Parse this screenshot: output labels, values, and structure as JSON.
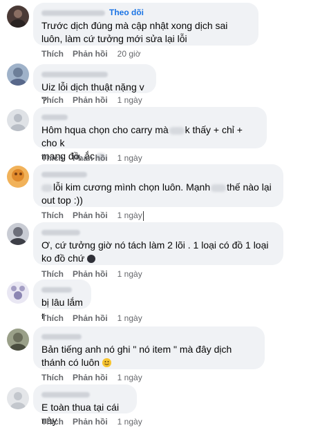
{
  "actions": {
    "like_label": "Thích",
    "reply_label": "Phản hồi"
  },
  "comments": [
    {
      "author_follow_label": "Theo dõi",
      "text_plain": "Trước dịch đúng mà cập nhật xong dịch sai luôn, làm cứ tưởng mới sửa lại lỗi",
      "time": "20 giờ",
      "avatar_color": "#4a3a36"
    },
    {
      "text_plain": "Uiz lỗi dịch thuật nặng v ?",
      "time": "1 ngày",
      "avatar_color": "#7c8fa8"
    },
    {
      "text_line1_a": "Hôm hqua chọn cho carry mà",
      "text_line1_b": "k thấy + chỉ + cho k",
      "text_line2_a": "mang đồ, ắc",
      "time": "1 ngày",
      "avatar_color": "#d7dbe0"
    },
    {
      "text_line1_a": "lỗi kim cương mình chọn luôn. Mạnh",
      "text_line1_b": "thế nào lại",
      "text_line2": "out top :))",
      "time": "1 ngày",
      "avatar_color": "#e08a2c"
    },
    {
      "text_plain": "Ơ, cứ tưởng giờ nó tách làm 2 lõi . 1 loại có đồ 1 loại ko đồ chứ",
      "time": "1 ngày",
      "avatar_color": "#6d6f7a"
    },
    {
      "text_plain": "bị lâu lắm r",
      "time": "1 ngày",
      "avatar_color": "#a49ec4"
    },
    {
      "text_plain": "Bản tiếng anh nó ghi \" nó item \" mà đây dịch thánh có luôn",
      "time": "1 ngày",
      "avatar_color": "#6b6e5c"
    },
    {
      "text_plain": "E toàn thua tại cái này",
      "time": "1 ngày",
      "avatar_color": "#d3d6da"
    }
  ]
}
